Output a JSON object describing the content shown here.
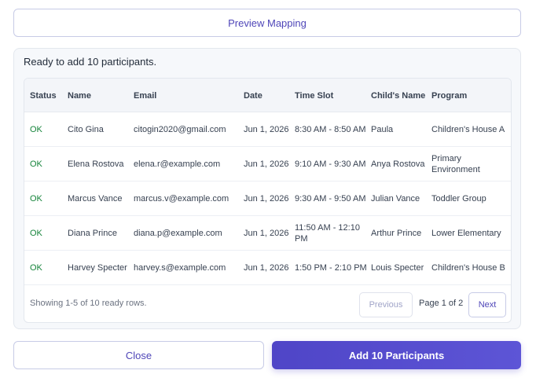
{
  "preview_button": "Preview Mapping",
  "panel": {
    "message": "Ready to add 10 participants."
  },
  "table": {
    "columns": {
      "status": "Status",
      "name": "Name",
      "email": "Email",
      "date": "Date",
      "time_slot": "Time Slot",
      "child": "Child's Name",
      "program": "Program"
    },
    "rows": [
      {
        "status": "OK",
        "name": "Cito Gina",
        "email": "citogin2020@gmail.com",
        "date": "Jun 1, 2026",
        "time_slot": "8:30 AM - 8:50 AM",
        "child": "Paula",
        "program": "Children's House A"
      },
      {
        "status": "OK",
        "name": "Elena Rostova",
        "email": "elena.r@example.com",
        "date": "Jun 1, 2026",
        "time_slot": "9:10 AM - 9:30 AM",
        "child": "Anya Rostova",
        "program": "Primary Environment"
      },
      {
        "status": "OK",
        "name": "Marcus Vance",
        "email": "marcus.v@example.com",
        "date": "Jun 1, 2026",
        "time_slot": "9:30 AM - 9:50 AM",
        "child": "Julian Vance",
        "program": "Toddler Group"
      },
      {
        "status": "OK",
        "name": "Diana Prince",
        "email": "diana.p@example.com",
        "date": "Jun 1, 2026",
        "time_slot": "11:50 AM - 12:10 PM",
        "child": "Arthur Prince",
        "program": "Lower Elementary"
      },
      {
        "status": "OK",
        "name": "Harvey Specter",
        "email": "harvey.s@example.com",
        "date": "Jun 1, 2026",
        "time_slot": "1:50 PM - 2:10 PM",
        "child": "Louis Specter",
        "program": "Children's House B"
      }
    ]
  },
  "pagination": {
    "summary": "Showing 1-5 of 10 ready rows.",
    "previous_label": "Previous",
    "page_indicator": "Page 1 of 2",
    "next_label": "Next"
  },
  "actions": {
    "close_label": "Close",
    "add_label": "Add 10 Participants"
  },
  "colors": {
    "accent": "#4f46b8",
    "primary_button": "#4f45c7",
    "status_ok": "#16843b"
  }
}
